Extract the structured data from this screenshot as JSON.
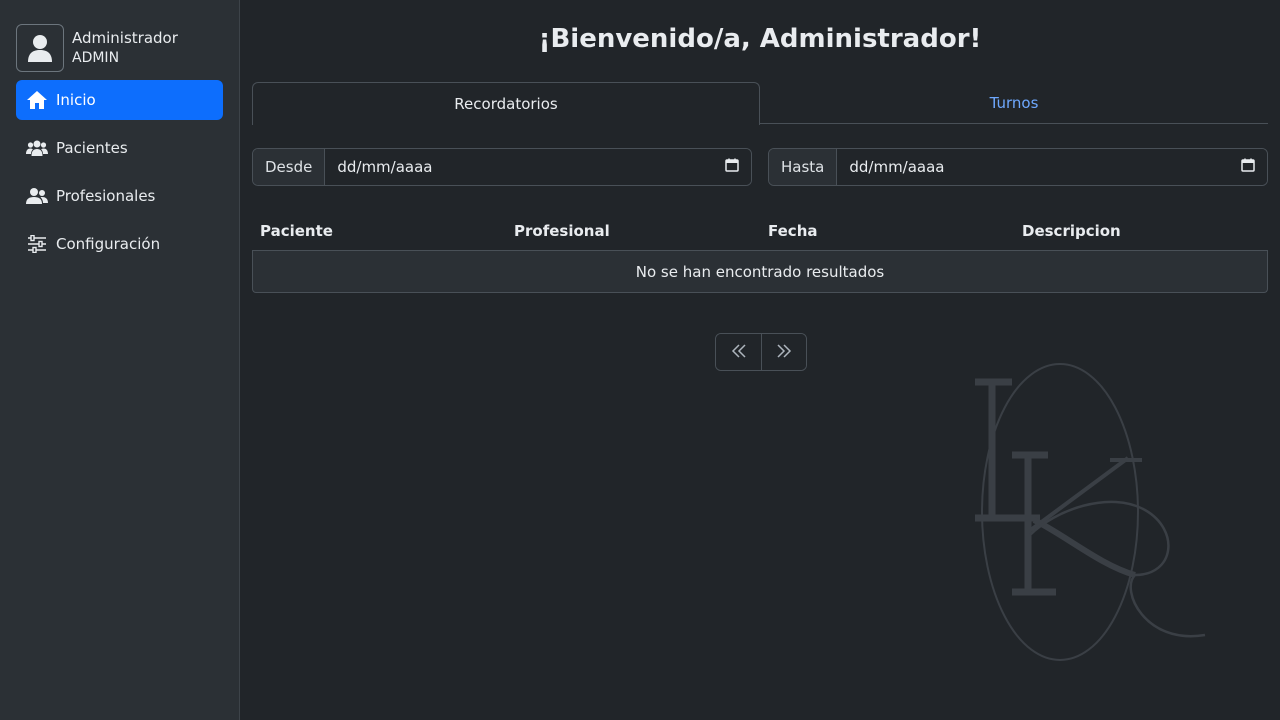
{
  "user": {
    "name": "Administrador",
    "role": "ADMIN",
    "avatar_icon": "user-avatar-icon"
  },
  "sidebar": {
    "items": [
      {
        "label": "Inicio",
        "icon": "home-icon",
        "active": true
      },
      {
        "label": "Pacientes",
        "icon": "users-icon",
        "active": false
      },
      {
        "label": "Profesionales",
        "icon": "user-group-icon",
        "active": false
      },
      {
        "label": "Configuración",
        "icon": "sliders-icon",
        "active": false
      }
    ]
  },
  "main": {
    "welcome": "¡Bienvenido/a, Administrador!",
    "tabs": [
      {
        "label": "Recordatorios",
        "active": true
      },
      {
        "label": "Turnos",
        "active": false
      }
    ],
    "filters": {
      "from_label": "Desde",
      "from_value": "dd/mm/aaaa",
      "to_label": "Hasta",
      "to_value": "dd/mm/aaaa"
    },
    "table": {
      "columns": [
        "Paciente",
        "Profesional",
        "Fecha",
        "Descripcion"
      ],
      "empty_message": "No se han encontrado resultados"
    },
    "pagination": {
      "prev_icon": "chevrons-left-icon",
      "next_icon": "chevrons-right-icon"
    }
  },
  "colors": {
    "accent": "#0d6efd",
    "link": "#6ea8fe",
    "background": "#212529",
    "sidebar": "#2b3035"
  }
}
